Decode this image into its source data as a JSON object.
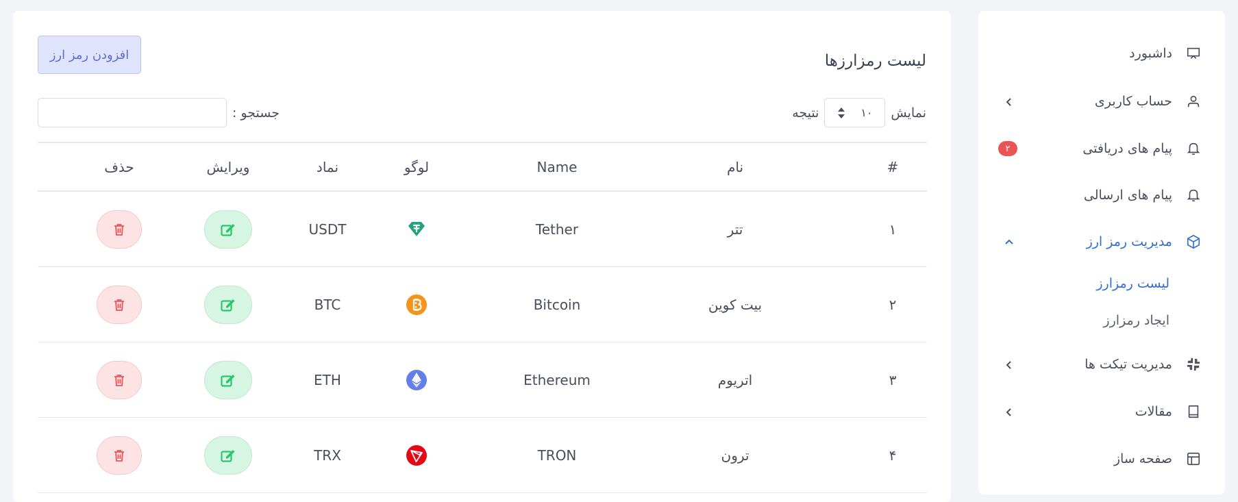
{
  "sidebar": {
    "items": [
      {
        "label": "داشبورد",
        "icon": "monitor-icon"
      },
      {
        "label": "حساب کاربری",
        "icon": "user-icon"
      },
      {
        "label": "پیام های دریافتی",
        "icon": "bell-icon",
        "badge": "۲"
      },
      {
        "label": "پیام های ارسالی",
        "icon": "bell-icon"
      },
      {
        "label": "مدیریت رمز ارز",
        "icon": "box-icon"
      },
      {
        "label": "مدیریت تیکت ها",
        "icon": "slack-icon"
      },
      {
        "label": "مقالات",
        "icon": "book-icon"
      },
      {
        "label": "صفحه ساز",
        "icon": "layout-icon"
      }
    ],
    "subitems": [
      {
        "label": "لیست رمزارز"
      },
      {
        "label": "ایجاد رمزارز"
      }
    ]
  },
  "main": {
    "title": "لیست رمزارزها",
    "add_button": "افزودن رمز ارز",
    "length": {
      "show_label": "نمایش",
      "value": "۱۰",
      "result_label": "نتیجه"
    },
    "search": {
      "label": "جستجو :",
      "value": ""
    },
    "table": {
      "headers": [
        "#",
        "نام",
        "Name",
        "لوگو",
        "نماد",
        "ویرایش",
        "حذف"
      ],
      "rows": [
        {
          "num": "۱",
          "name": "تتر",
          "en": "Tether",
          "logo": "tether-logo",
          "symbol": "USDT"
        },
        {
          "num": "۲",
          "name": "بیت کوین",
          "en": "Bitcoin",
          "logo": "bitcoin-logo",
          "symbol": "BTC"
        },
        {
          "num": "۳",
          "name": "اتریوم",
          "en": "Ethereum",
          "logo": "ethereum-logo",
          "symbol": "ETH"
        },
        {
          "num": "۴",
          "name": "ترون",
          "en": "TRON",
          "logo": "tron-logo",
          "symbol": "TRX"
        }
      ]
    }
  },
  "colors": {
    "accent": "#2f6fd4",
    "badge": "#ea5455",
    "edit_bg": "#d6f5e2",
    "edit_icon": "#28c76f",
    "delete_bg": "#fde3e3",
    "delete_icon": "#ea5455",
    "tether": "#26a17b",
    "bitcoin": "#f7931a",
    "ethereum": "#627eea",
    "tron": "#e50915"
  }
}
